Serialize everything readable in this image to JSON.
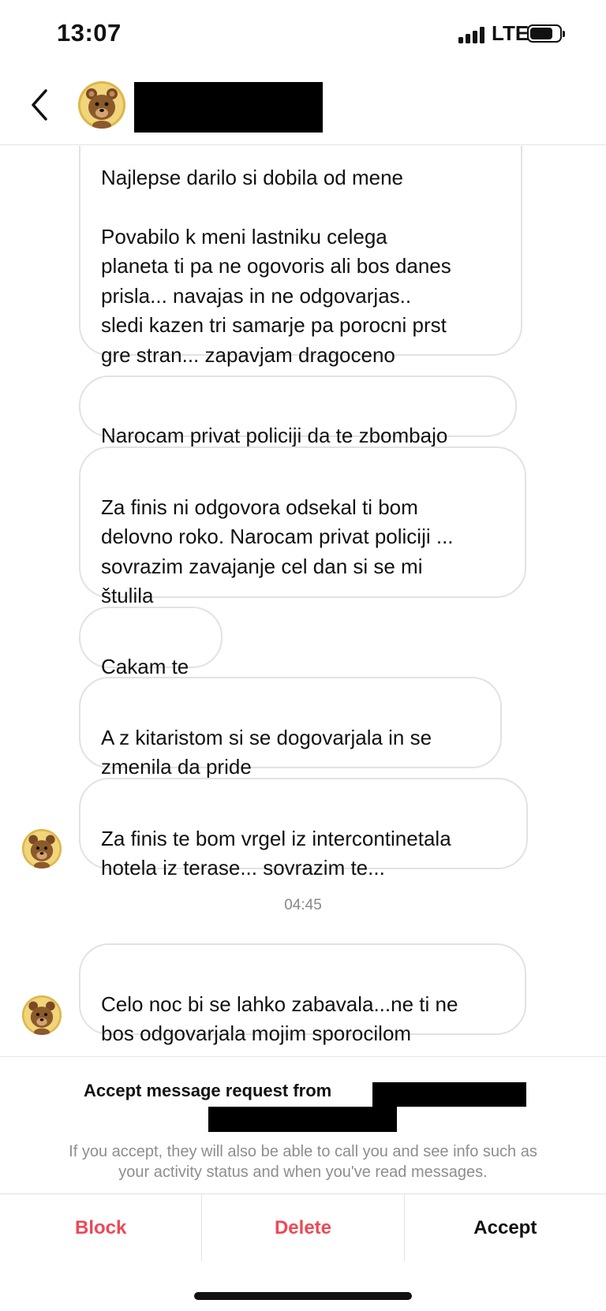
{
  "status_bar": {
    "time": "13:07",
    "network": "LTE",
    "battery_level": 0.7
  },
  "header": {
    "back_icon": "chevron-left-icon",
    "avatar_icon": "bear-avatar-icon"
  },
  "messages": [
    {
      "text": "Najlepse darilo si dobila od mene"
    },
    {
      "text": "Povabilo k meni lastniku celega\nplaneta ti pa ne ogovoris ali bos danes\nprisla... navajas in ne odgovarjas..\nsledi kazen tri samarje pa porocni prst\ngre stran... zapavjam dragoceno\nenegijo zate novinarska kuba"
    },
    {
      "text": "Narocam privat policiji da te zbombajo"
    },
    {
      "text": "Za finis ni odgovora odsekal ti bom\ndelovno roko. Narocam privat policiji ...\nsovrazim zavajanje cel dan si se mi\nštulila"
    },
    {
      "text": "Cakam te"
    },
    {
      "text": "A z kitaristom si se dogovarjala in se\nzmenila da pride"
    },
    {
      "text": "Za finis te bom vrgel iz intercontinetala\nhotela iz terase... sovrazim te..."
    },
    {
      "text": "Celo noc bi se lahko zabavala...ne ti ne\nbos odgovarjala mojim sporocilom"
    }
  ],
  "timestamp": "04:45",
  "request": {
    "title": "Accept message request from",
    "description": "If you accept, they will also be able to call you and see info such as\nyour activity status and when you've read messages."
  },
  "actions": {
    "block": "Block",
    "delete": "Delete",
    "accept": "Accept"
  },
  "colors": {
    "danger": "#ed4956",
    "bubble_border": "#e2e2e2",
    "muted_text": "#8e8e8e"
  }
}
